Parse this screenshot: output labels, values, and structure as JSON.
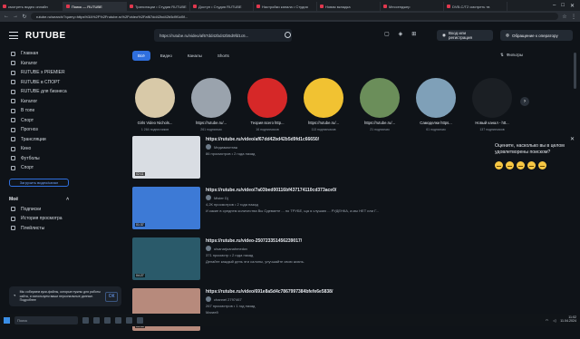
{
  "browser": {
    "tabs": [
      {
        "label": "смотреть видео онлайн",
        "active": false
      },
      {
        "label": "Поиск — RUTUBE",
        "active": true
      },
      {
        "label": "Трансляции • Студия RUTUBE",
        "active": false
      },
      {
        "label": "Доступ • Студия RUTUBE",
        "active": false
      },
      {
        "label": "Настройки канала • Студия",
        "active": false
      },
      {
        "label": "Новая вкладка",
        "active": false
      },
      {
        "label": "Мессенджер",
        "active": false
      },
      {
        "label": "DVB-C/T2 смотреть тв",
        "active": false
      }
    ],
    "url": "rutube.ru/search/?query=https%3A%2F%2Frutube.ru%2Fvideo%2Faf67dd42bd42b5d9f1d5f..."
  },
  "header": {
    "logo": "RUTUBE",
    "search_value": "https://rutube.ru/video/af67dd42bd42b5d9fd1c6...",
    "login_label": "Вход или регистрация",
    "wallet_label": "Обращение к оператору"
  },
  "sidebar": {
    "items": [
      {
        "label": "Главная"
      },
      {
        "label": "Каталог"
      },
      {
        "label": "RUTUBE x PREMIER"
      },
      {
        "label": "RUTUBE в СПОРТ"
      },
      {
        "label": "RUTUBE для бизнеса"
      },
      {
        "label": "Каталог"
      },
      {
        "label": "В топе"
      },
      {
        "label": "Спорт"
      },
      {
        "label": "Прогноз"
      },
      {
        "label": "Трансляции"
      },
      {
        "label": "Кино"
      },
      {
        "label": "Футболы"
      },
      {
        "label": "Спорт"
      }
    ],
    "create_button": "Загрузить видео/канал",
    "section_title": "Моё",
    "my_items": [
      {
        "label": "Подписки"
      },
      {
        "label": "История просмотра"
      },
      {
        "label": "Плейлисты"
      }
    ]
  },
  "filters": {
    "chips": [
      {
        "label": "Всё",
        "active": true
      },
      {
        "label": "Видео",
        "active": false
      },
      {
        "label": "Каналы",
        "active": false
      },
      {
        "label": "Shorts",
        "active": false
      }
    ],
    "filter_label": "Фильтры"
  },
  "channels": [
    {
      "name": "Girls Video Nichols...",
      "subs": "1 264 подписчиков",
      "color": "#d8c9a8"
    },
    {
      "name": "https://rutube.ru/...",
      "subs": "261 подписчик",
      "color": "#9aa3ad"
    },
    {
      "name": "Теория всего http...",
      "subs": "16 подписчиков",
      "color": "#d62828"
    },
    {
      "name": "https://rutube.ru/...",
      "subs": "113 подписчиков",
      "color": "#f1c232"
    },
    {
      "name": "https://rutube.ru/...",
      "subs": "21 подписчик",
      "color": "#6b8e5a"
    },
    {
      "name": "Самоделки https...",
      "subs": "61 подписчик",
      "color": "#7fa0b8"
    },
    {
      "name": "Новый канал - htt...",
      "subs": "137 подписчиков",
      "color": "#1b1f24"
    }
  ],
  "videos": [
    {
      "title": "https://rutube.ru/video/af67dd42bd42b5d9fd1c66650/",
      "channel": "Медиамонтаж",
      "meta": "86 просмотров • 2 года назад",
      "description": "",
      "duration": "02:11",
      "color": "#d9dde3"
    },
    {
      "title": "https://rutube.ru/video/7a03bed00116bf437174110cd373ace0/",
      "channel": "Mister Dj",
      "meta": "4,2К просмотров • 2 года назад",
      "description": "И какие в среднем количества Вы Одеваете ... по ТРУБЕ, ща я слушаю ... РУДЕНКА, а мы НЕТ или Г...",
      "duration": "01:37",
      "color": "#3d7ad6"
    },
    {
      "title": "https://rutube.ru/video-250723351456239017/",
      "channel": "ulsanarjuanahmedov",
      "meta": "371 просмотр • 2 года назад",
      "description": "Делайте каждый день эти салоны, улучшайте свою жизнь.",
      "duration": "04:27",
      "color": "#2a5a6a"
    },
    {
      "title": "https://rutube.ru/video/691e8a5d4c7867997384bfefe6e5838/",
      "channel": "channel 2797467",
      "meta": "267 просмотров • 1 год назад",
      "description": "Магией",
      "duration": "03:35",
      "color": "#b78a7c"
    }
  ],
  "survey": {
    "question": "Оцените, насколько вы в целом удовлетворены поиском?",
    "emoji_count": 5
  },
  "cookie": {
    "text": "Мы собираем куки-файлы, которые нужны для работы сайта, и используем ваши персональные данные. Подробнее",
    "button": "ОК"
  },
  "taskbar": {
    "search_placeholder": "Поиск",
    "time": "11:02",
    "date": "11.04.2024"
  }
}
